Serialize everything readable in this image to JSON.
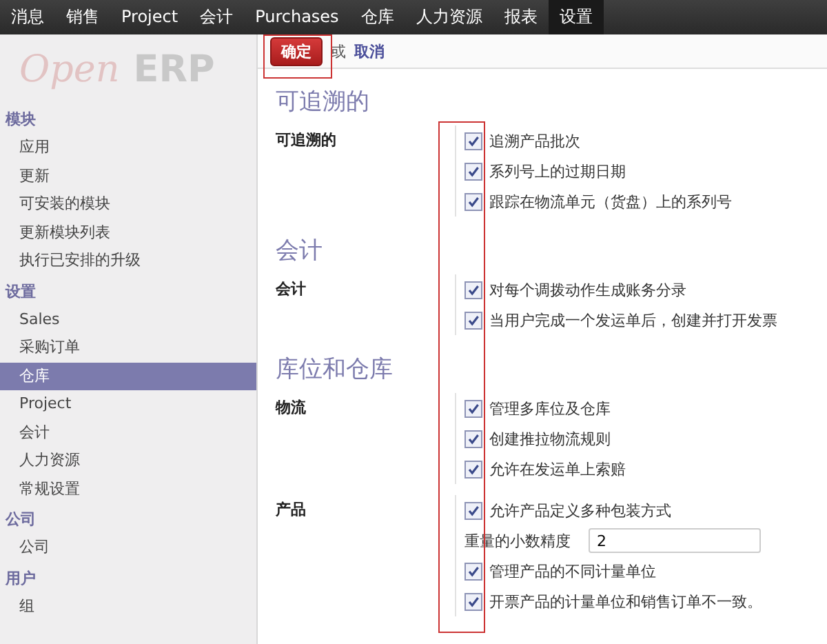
{
  "top_menu": [
    {
      "label": "消息",
      "selected": false
    },
    {
      "label": "销售",
      "selected": false
    },
    {
      "label": "Project",
      "selected": false
    },
    {
      "label": "会计",
      "selected": false
    },
    {
      "label": "Purchases",
      "selected": false
    },
    {
      "label": "仓库",
      "selected": false
    },
    {
      "label": "人力资源",
      "selected": false
    },
    {
      "label": "报表",
      "selected": false
    },
    {
      "label": "设置",
      "selected": true
    }
  ],
  "logo": {
    "brand": "Open",
    "suffix": "ERP"
  },
  "sidebar": [
    {
      "heading": "模块",
      "items": [
        {
          "label": "应用",
          "selected": false
        },
        {
          "label": "更新",
          "selected": false
        },
        {
          "label": "可安装的模块",
          "selected": false
        },
        {
          "label": "更新模块列表",
          "selected": false
        },
        {
          "label": "执行已安排的升级",
          "selected": false
        }
      ]
    },
    {
      "heading": "设置",
      "items": [
        {
          "label": "Sales",
          "selected": false
        },
        {
          "label": "采购订单",
          "selected": false
        },
        {
          "label": "仓库",
          "selected": true
        },
        {
          "label": "Project",
          "selected": false
        },
        {
          "label": "会计",
          "selected": false
        },
        {
          "label": "人力资源",
          "selected": false
        },
        {
          "label": "常规设置",
          "selected": false
        }
      ]
    },
    {
      "heading": "公司",
      "items": [
        {
          "label": "公司",
          "selected": false
        }
      ]
    },
    {
      "heading": "用户",
      "items": [
        {
          "label": "组",
          "selected": false
        }
      ]
    }
  ],
  "toolbar": {
    "apply_button": {
      "label": "确定",
      "highlighted": true
    },
    "separator": "或",
    "cancel_link": "取消"
  },
  "sections": [
    {
      "title": "可追溯的",
      "groups": [
        {
          "label": "可追溯的",
          "options": [
            {
              "kind": "checkbox",
              "label": "追溯产品批次",
              "checked": true
            },
            {
              "kind": "checkbox",
              "label": "系列号上的过期日期",
              "checked": true
            },
            {
              "kind": "checkbox",
              "label": "跟踪在物流单元（货盘）上的系列号",
              "checked": true
            }
          ]
        }
      ]
    },
    {
      "title": "会计",
      "groups": [
        {
          "label": "会计",
          "options": [
            {
              "kind": "checkbox",
              "label": "对每个调拨动作生成账务分录",
              "checked": true
            },
            {
              "kind": "checkbox",
              "label": "当用户完成一个发运单后，创建并打开发票",
              "checked": true
            }
          ]
        }
      ]
    },
    {
      "title": "库位和仓库",
      "groups": [
        {
          "label": "物流",
          "options": [
            {
              "kind": "checkbox",
              "label": "管理多库位及仓库",
              "checked": true
            },
            {
              "kind": "checkbox",
              "label": "创建推拉物流规则",
              "checked": true
            },
            {
              "kind": "checkbox",
              "label": "允许在发运单上索赔",
              "checked": true
            }
          ]
        },
        {
          "label": "产品",
          "options": [
            {
              "kind": "checkbox",
              "label": "允许产品定义多种包装方式",
              "checked": true
            },
            {
              "kind": "number",
              "label": "重量的小数精度",
              "value": "2"
            },
            {
              "kind": "checkbox",
              "label": "管理产品的不同计量单位",
              "checked": true
            },
            {
              "kind": "checkbox",
              "label": "开票产品的计量单位和销售订单不一致。",
              "checked": true
            }
          ]
        }
      ]
    }
  ],
  "checkbox_column_highlighted": true
}
